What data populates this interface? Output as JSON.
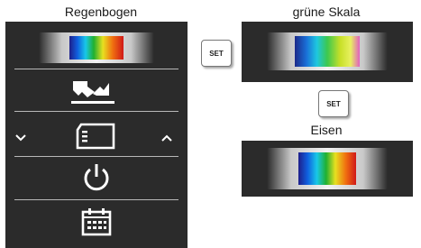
{
  "left": {
    "title": "Regenbogen",
    "selected_palette": "rainbow",
    "menu_icons": [
      "palette-icon",
      "emissivity-icon",
      "sd-card-icon",
      "power-icon",
      "calendar-icon"
    ]
  },
  "nav": {
    "prev_icon": "chevron-down-icon",
    "next_icon": "chevron-up-icon"
  },
  "set_button_label": "SET",
  "palettes": [
    {
      "name": "grüne Skala",
      "id": "green-scale"
    },
    {
      "name": "Eisen",
      "id": "iron"
    }
  ],
  "colors": {
    "panel": "#2b2b2b",
    "separator": "#b8b8b8"
  }
}
